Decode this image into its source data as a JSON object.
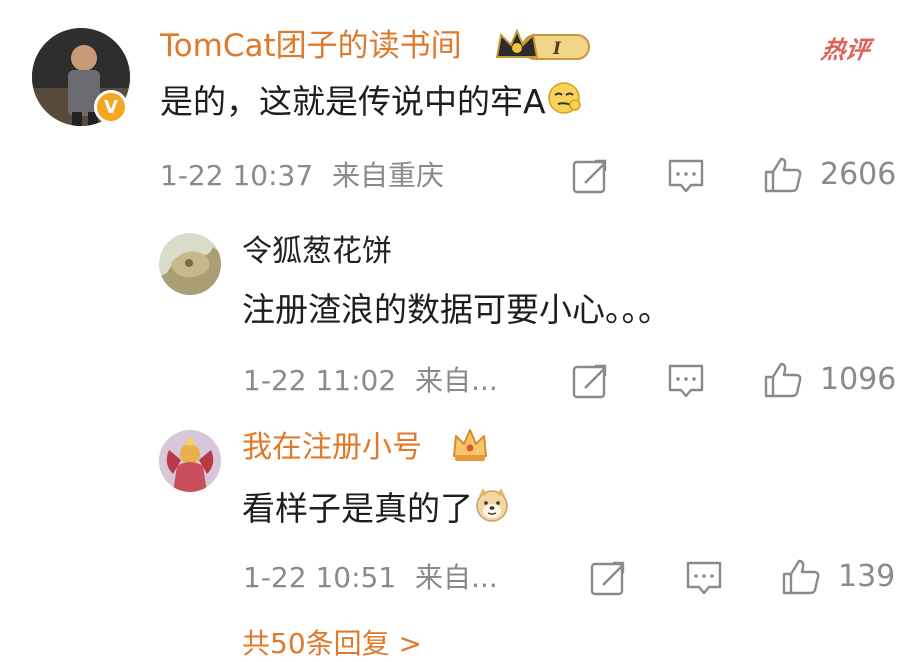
{
  "main_comment": {
    "username": "TomCat团子的读书间",
    "badge_level": "I",
    "hot_label": "热评",
    "text": "是的，这就是传说中的牢A",
    "time": "1-22 10:37",
    "source": "来自重庆",
    "like_count": "2606"
  },
  "replies": [
    {
      "username": "令狐葱花饼",
      "text": "注册渣浪的数据可要小心。。。",
      "time": "1-22 11:02",
      "source": "来自...",
      "like_count": "1096"
    },
    {
      "username": "我在注册小号",
      "text": "看样子是真的了",
      "time": "1-22 10:51",
      "source": "来自...",
      "like_count": "139"
    }
  ],
  "more_replies": "共50条回复 >",
  "icons": {
    "verified": "verified-v-icon",
    "repost": "repost-icon",
    "comment": "comment-icon",
    "like": "thumbs-up-icon",
    "crown": "crown-icon"
  },
  "colors": {
    "username": "#e0792b",
    "meta": "#8a8a8a",
    "hot": "#e0605a",
    "badge": "#f5a623"
  }
}
